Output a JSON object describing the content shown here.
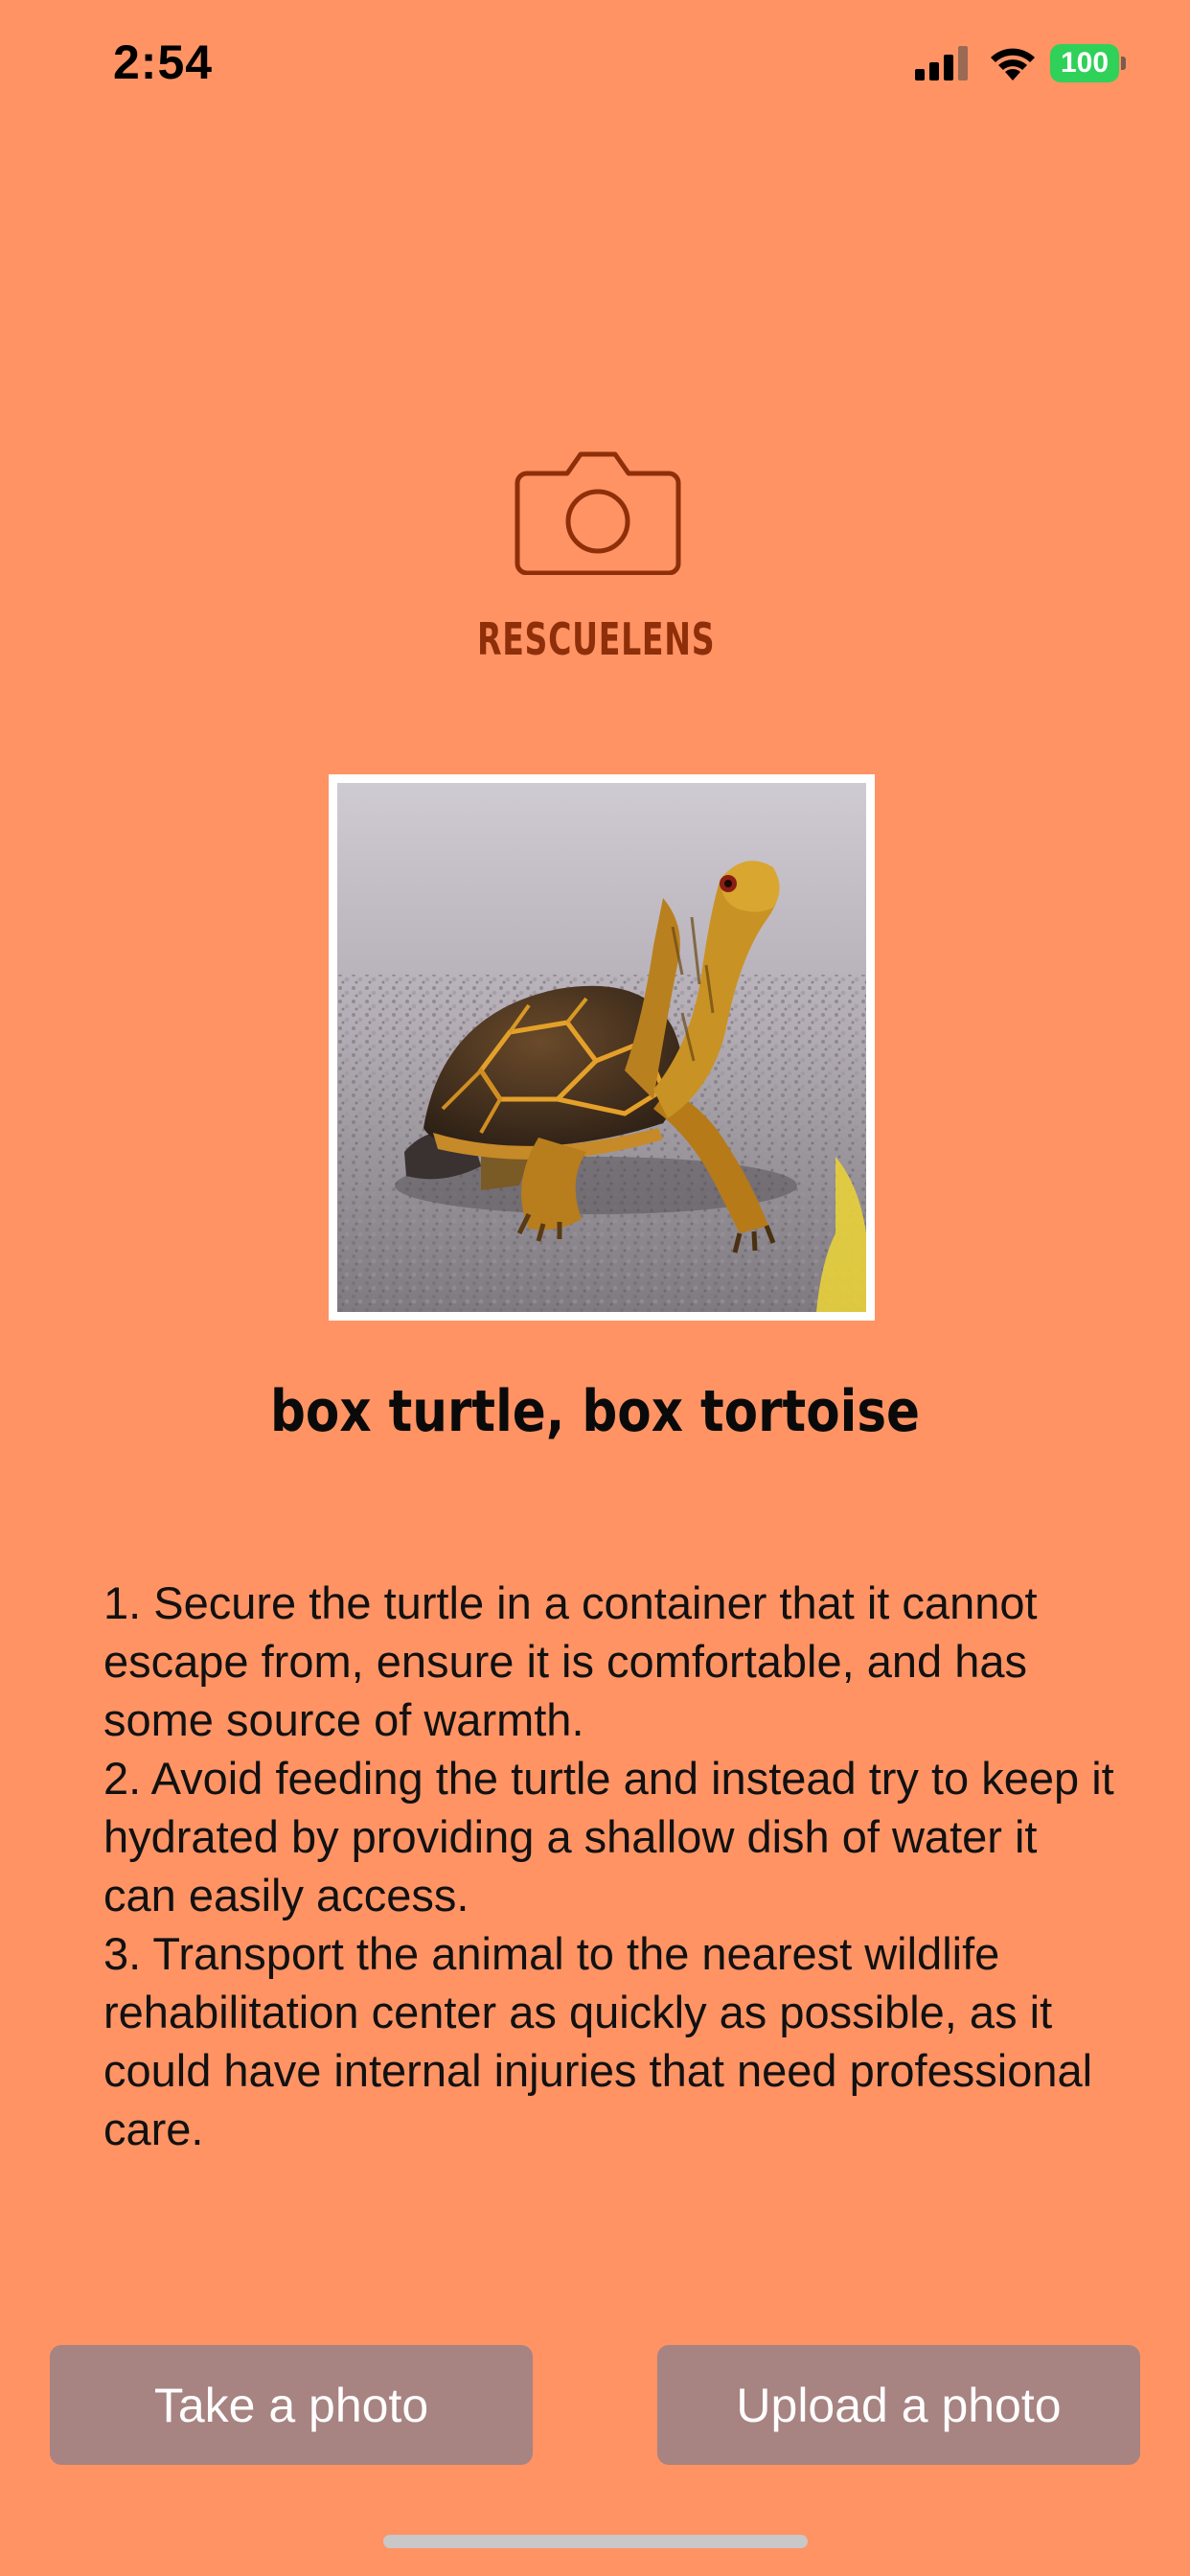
{
  "status_bar": {
    "time": "2:54",
    "battery_level": "100",
    "icons": [
      "signal-icon",
      "wifi-icon",
      "battery-icon"
    ]
  },
  "header": {
    "logo_icon": "camera-icon",
    "app_name": "RESCUELENS"
  },
  "result": {
    "species": "box turtle, box tortoise",
    "instructions": [
      "1. Secure the turtle in a container that it cannot escape from, ensure it is comfortable, and has some source of warmth.",
      "2. Avoid feeding the turtle and instead try to keep it hydrated by providing a shallow dish of water it can easily access.",
      "3. Transport the animal to the nearest wildlife rehabilitation center as quickly as possible, as it could have internal injuries that need professional care."
    ]
  },
  "actions": {
    "take_photo": "Take a photo",
    "upload_photo": "Upload a photo"
  },
  "colors": {
    "background": "#FF9364",
    "title": "#8E2F0A",
    "button": "#A78382",
    "battery": "#30D158"
  }
}
